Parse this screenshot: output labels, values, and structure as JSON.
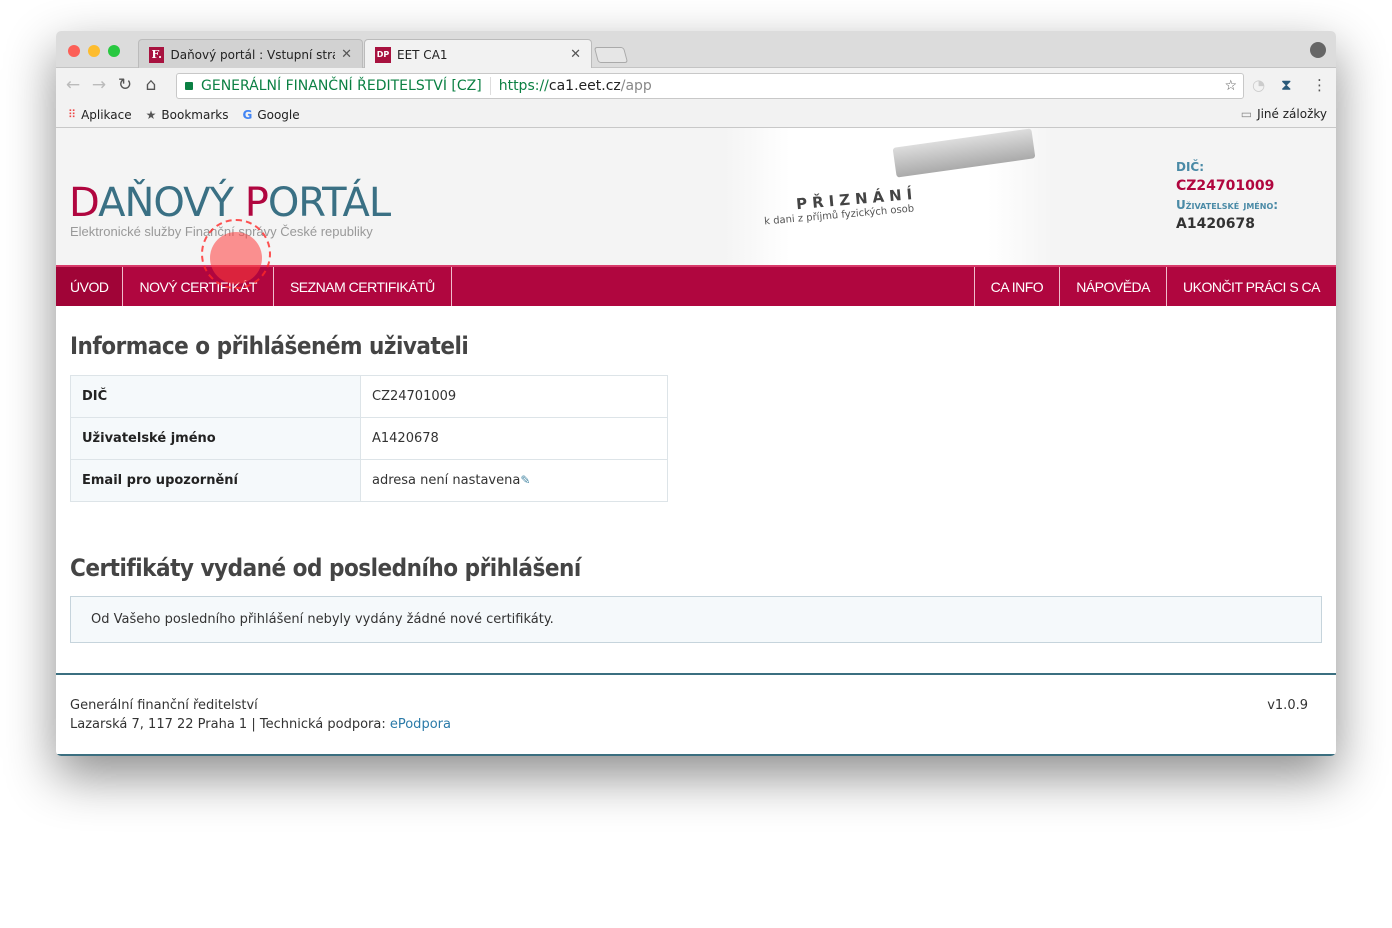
{
  "browser": {
    "tabs": [
      {
        "title": "Daňový portál :  Vstupní strán",
        "favicon": "F."
      },
      {
        "title": "EET CA1",
        "favicon": "DP"
      }
    ],
    "address": {
      "ev_label": "GENERÁLNÍ FINANČNÍ ŘEDITELSTVÍ [CZ]",
      "scheme": "https://",
      "host": "ca1.eet.cz",
      "path": "/app"
    },
    "bookmarks": [
      {
        "label": "Aplikace"
      },
      {
        "label": "Bookmarks"
      },
      {
        "label": "Google"
      }
    ],
    "other_bookmarks": "Jiné záložky"
  },
  "header": {
    "logo_d": "D",
    "logo_rest1": "AŇOVÝ ",
    "logo_p": "P",
    "logo_rest2": "ORTÁL",
    "slogan": "Elektronické služby Finanční správy České republiky",
    "banner_title": "PŘIZNÁNÍ",
    "banner_sub": "k dani z příjmů fyzických osob",
    "dic_label": "DIČ:",
    "dic_value": "CZ24701009",
    "user_label": "Uživatelské jméno:",
    "user_value": "A1420678"
  },
  "nav": {
    "left": [
      "ÚVOD",
      "NOVÝ CERTIFIKÁT",
      "SEZNAM CERTIFIKÁTŮ"
    ],
    "right": [
      "CA INFO",
      "NÁPOVĚDA",
      "UKONČIT PRÁCI S CA"
    ]
  },
  "main": {
    "info_title": "Informace o přihlášeném uživateli",
    "rows": [
      {
        "k": "DIČ",
        "v": "CZ24701009"
      },
      {
        "k": "Uživatelské jméno",
        "v": "A1420678"
      },
      {
        "k": "Email pro upozornění",
        "v": "adresa není nastavena"
      }
    ],
    "certs_title": "Certifikáty vydané od posledního přihlášení",
    "certs_message": "Od Vašeho posledního přihlášení nebyly vydány žádné nové certifikáty."
  },
  "footer": {
    "org": "Generální finanční ředitelství",
    "address": "Lazarská 7, 117 22 Praha 1 | Technická podpora: ",
    "support_link": "ePodpora",
    "version": "v1.0.9"
  },
  "colors": {
    "brand": "#b0063f",
    "accent": "#3a7084"
  }
}
